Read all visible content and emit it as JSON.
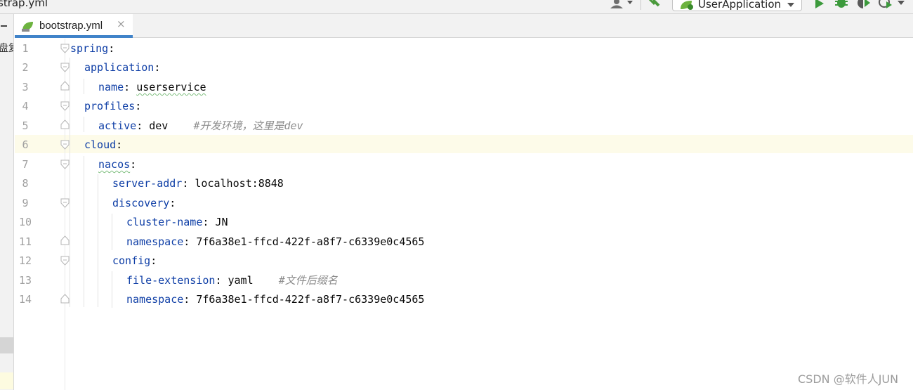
{
  "window": {
    "open_file_partial": "strap.yml"
  },
  "toolbar": {
    "run_config": "UserApplication",
    "icons": [
      "user-icon",
      "hammer-icon",
      "run-icon",
      "debug-icon",
      "coverage-icon",
      "profiler-icon"
    ]
  },
  "left_panel": {
    "partial_text": "盘复"
  },
  "tabs": [
    {
      "label": "bootstrap.yml",
      "icon": "yaml-file-icon",
      "active": true
    }
  ],
  "editor": {
    "caret_line": 6,
    "lines": [
      {
        "n": "1",
        "key": "spring",
        "sep": ":",
        "value": "",
        "comment": ""
      },
      {
        "n": "2",
        "key": "application",
        "sep": ":",
        "value": "",
        "comment": ""
      },
      {
        "n": "3",
        "key": "name",
        "sep": ": ",
        "value": "userservice",
        "comment": ""
      },
      {
        "n": "4",
        "key": "profiles",
        "sep": ":",
        "value": "",
        "comment": ""
      },
      {
        "n": "5",
        "key": "active",
        "sep": ": ",
        "value": "dev",
        "comment": "#开发环境，这里是dev"
      },
      {
        "n": "6",
        "key": "cloud",
        "sep": ":",
        "value": "",
        "comment": ""
      },
      {
        "n": "7",
        "key": "nacos",
        "sep": ":",
        "value": "",
        "comment": ""
      },
      {
        "n": "8",
        "key": "server-addr",
        "sep": ": ",
        "value": "localhost:8848",
        "comment": ""
      },
      {
        "n": "9",
        "key": "discovery",
        "sep": ":",
        "value": "",
        "comment": ""
      },
      {
        "n": "10",
        "key": "cluster-name",
        "sep": ": ",
        "value": "JN",
        "comment": ""
      },
      {
        "n": "11",
        "key": "namespace",
        "sep": ": ",
        "value": "7f6a38e1-ffcd-422f-a8f7-c6339e0c4565",
        "comment": ""
      },
      {
        "n": "12",
        "key": "config",
        "sep": ":",
        "value": "",
        "comment": ""
      },
      {
        "n": "13",
        "key": "file-extension",
        "sep": ": ",
        "value": "yaml",
        "comment": "#文件后缀名"
      },
      {
        "n": "14",
        "key": "namespace",
        "sep": ": ",
        "value": "7f6a38e1-ffcd-422f-a8f7-c6339e0c4565",
        "comment": ""
      }
    ]
  },
  "watermark": "CSDN @软件人JUN",
  "colors": {
    "key": "#0e3ea6",
    "comment": "#8c8c8c",
    "tab_accent": "#4083c9",
    "caret_row": "#fdfbe9"
  }
}
